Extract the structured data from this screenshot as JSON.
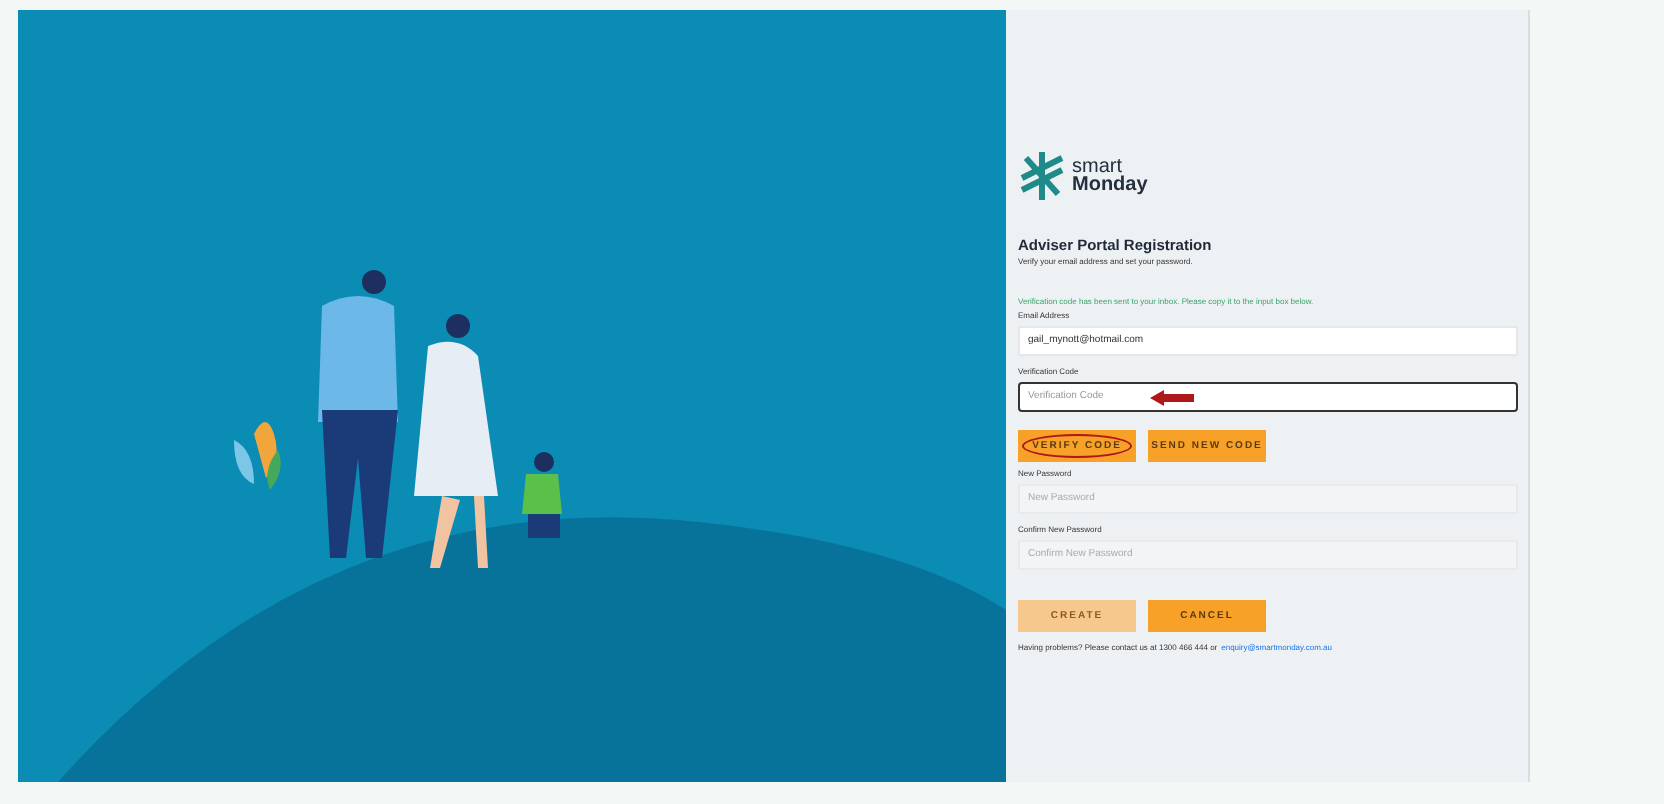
{
  "logo": {
    "line_1": "smart",
    "line_2": "Monday"
  },
  "form": {
    "title": "Adviser Portal Registration",
    "subtitle": "Verify your email address and set your password.",
    "notice": "Verification code has been sent to your inbox. Please copy it to the input box below.",
    "fields": [
      {
        "label": "Email Address",
        "value": "gail_mynott@hotmail.com",
        "highlighted": false
      },
      {
        "label": "Verification Code",
        "placeholder": "Verification Code",
        "highlighted": true
      }
    ],
    "code_buttons": [
      {
        "label": "VERIFY CODE",
        "disabled": false,
        "circled": true
      },
      {
        "label": "SEND NEW CODE",
        "disabled": false,
        "circled": false
      }
    ],
    "password_fields": [
      {
        "label": "New Password",
        "placeholder": "New Password"
      },
      {
        "label": "Confirm New Password",
        "placeholder": "Confirm New Password"
      }
    ],
    "buttons": [
      {
        "label": "CREATE",
        "disabled": true
      },
      {
        "label": "CANCEL",
        "disabled": false
      }
    ],
    "help": {
      "text": "Having problems? Please contact us at 1300 466 444 or",
      "link": "enquiry@smartmonday.com.au"
    }
  }
}
